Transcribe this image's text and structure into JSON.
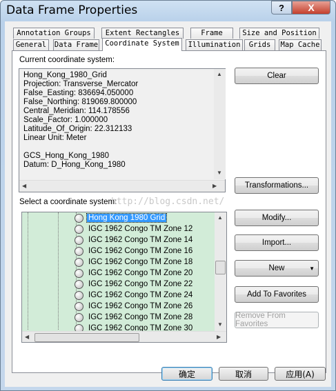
{
  "window": {
    "title": "Data Frame Properties",
    "help": "?",
    "close": "X"
  },
  "tabs_row1": [
    "Annotation Groups",
    "Extent Rectangles",
    "Frame",
    "Size and Position"
  ],
  "tabs_row2": [
    "General",
    "Data Frame",
    "Coordinate System",
    "Illumination",
    "Grids",
    "Map Cache"
  ],
  "active_tab": "Coordinate System",
  "current": {
    "label": "Current coordinate system:",
    "lines": [
      "Hong_Kong_1980_Grid",
      "Projection: Transverse_Mercator",
      "False_Easting: 836694.050000",
      "False_Northing: 819069.800000",
      "Central_Meridian: 114.178556",
      "Scale_Factor: 1.000000",
      "Latitude_Of_Origin: 22.312133",
      "Linear Unit: Meter",
      "",
      "GCS_Hong_Kong_1980",
      "Datum: D_Hong_Kong_1980"
    ]
  },
  "select": {
    "label": "Select a coordinate system:",
    "items": [
      "Hong Kong 1980 Grid",
      "IGC 1962 Congo TM Zone 12",
      "IGC 1962 Congo TM Zone 14",
      "IGC 1962 Congo TM Zone 16",
      "IGC 1962 Congo TM Zone 18",
      "IGC 1962 Congo TM Zone 20",
      "IGC 1962 Congo TM Zone 22",
      "IGC 1962 Congo TM Zone 24",
      "IGC 1962 Congo TM Zone 26",
      "IGC 1962 Congo TM Zone 28",
      "IGC 1962 Congo TM Zone 30"
    ],
    "selected_index": 0
  },
  "watermark": "http://blog.csdn.net/",
  "buttons": {
    "clear": "Clear",
    "transformations": "Transformations...",
    "modify": "Modify...",
    "import": "Import...",
    "new": "New",
    "add_favorites": "Add To Favorites",
    "remove_favorites": "Remove From Favorites"
  },
  "footer": {
    "ok": "确定",
    "cancel": "取消",
    "apply": "应用(A)"
  }
}
